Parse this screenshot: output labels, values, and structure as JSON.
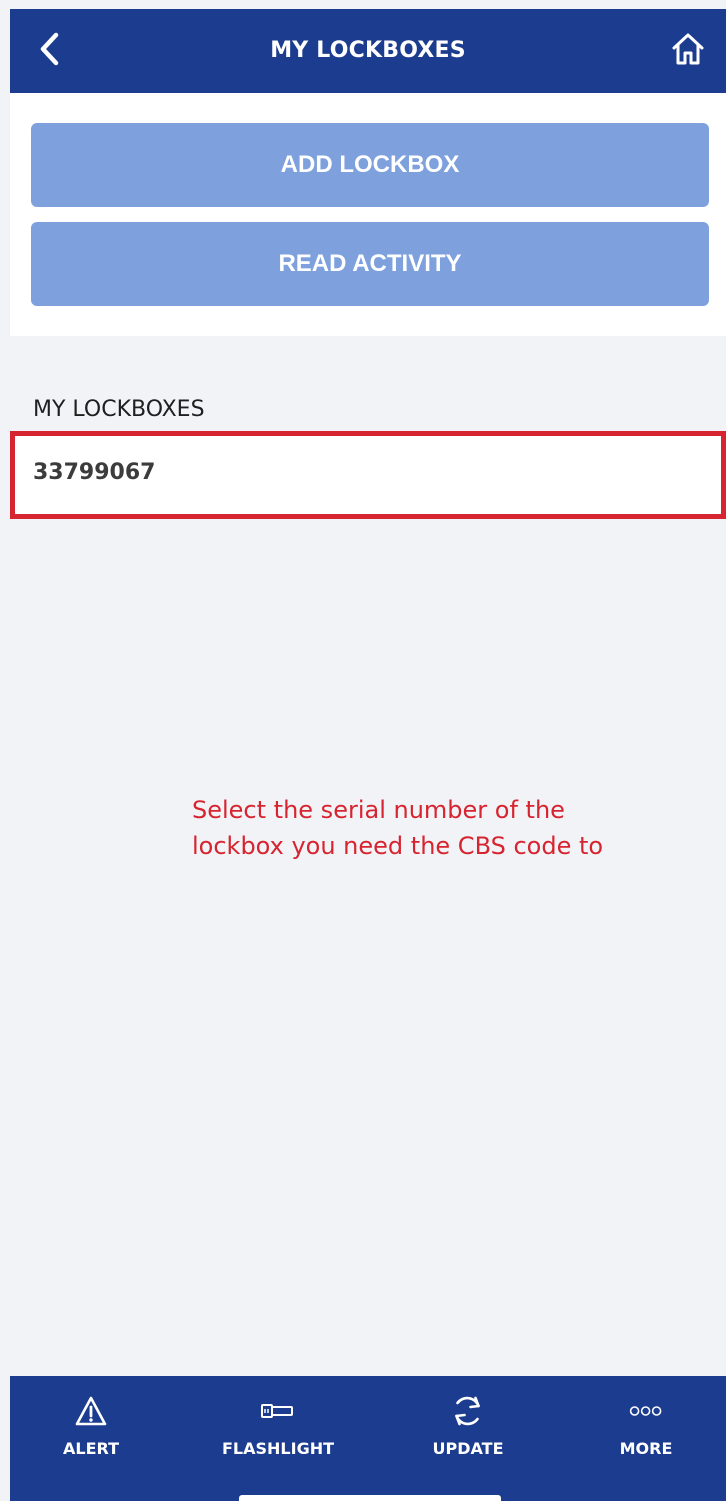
{
  "header": {
    "title": "MY LOCKBOXES",
    "back_icon": "chevron-left-icon",
    "home_icon": "home-icon"
  },
  "actions": {
    "add_label": "ADD LOCKBOX",
    "read_label": "READ ACTIVITY"
  },
  "lockboxes": {
    "section_label": "MY LOCKBOXES",
    "items": [
      {
        "serial": "33799067"
      }
    ]
  },
  "hint": {
    "text": "Select the serial number of the lockbox you need the CBS code to"
  },
  "bottom_nav": {
    "items": [
      {
        "label": "ALERT",
        "icon": "alert-icon"
      },
      {
        "label": "FLASHLIGHT",
        "icon": "flashlight-icon"
      },
      {
        "label": "UPDATE",
        "icon": "update-icon"
      },
      {
        "label": "MORE",
        "icon": "more-icon"
      }
    ]
  },
  "colors": {
    "brand": "#1c3d8f",
    "button": "#7ea1de",
    "highlight": "#d62430",
    "background": "#f2f3f6"
  }
}
